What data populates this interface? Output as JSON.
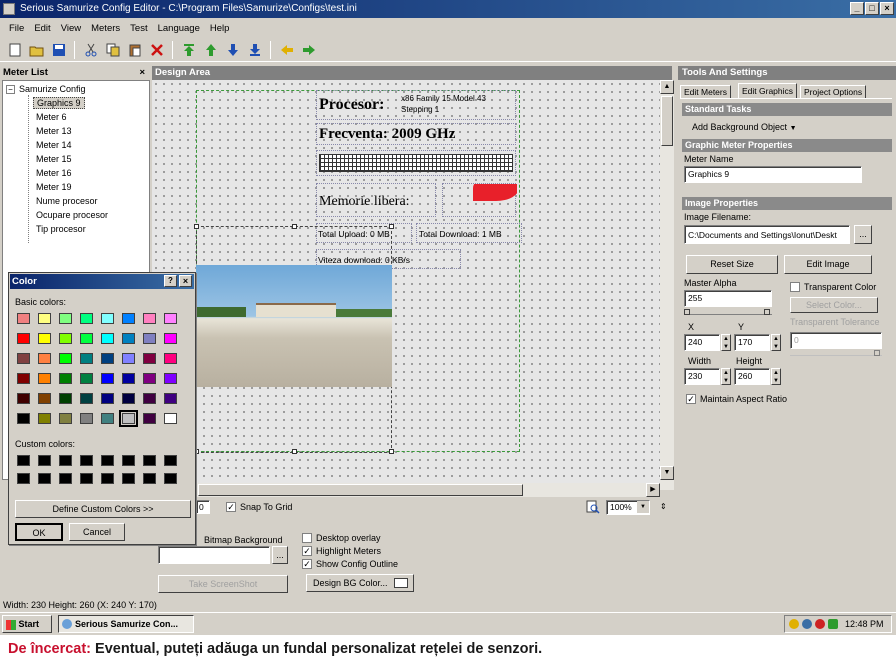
{
  "window": {
    "title": "Serious Samurize Config Editor - C:\\Program Files\\Samurize\\Configs\\test.ini",
    "controls": [
      "_",
      "□",
      "×"
    ]
  },
  "menu": [
    "File",
    "Edit",
    "View",
    "Meters",
    "Test",
    "Language",
    "Help"
  ],
  "toolbar": {
    "icons": [
      "new-icon",
      "open-icon",
      "save-icon",
      "cut-icon",
      "copy-icon",
      "paste-icon",
      "delete-icon",
      "move-top-icon",
      "move-up-icon",
      "move-down-icon",
      "move-bottom-icon",
      "back-icon",
      "forward-icon"
    ],
    "colors": {
      "green": "#2e9b2e",
      "blue": "#1f4fb3",
      "yellow": "#e0b000",
      "red": "#cc1111"
    }
  },
  "meter_list": {
    "title": "Meter List",
    "close": "×",
    "root": "Samurize Config",
    "items": [
      "Graphics 9",
      "Meter 6",
      "Meter 13",
      "Meter 14",
      "Meter 15",
      "Meter 16",
      "Meter 19",
      "Nume procesor",
      "Ocupare procesor",
      "Tip procesor"
    ]
  },
  "design_area": {
    "title": "Design Area",
    "meters": {
      "procesor_label": "Procesor:",
      "procesor_value": "x86 Family 15 Model 43 Stepping 1",
      "frecventa": "Frecventa: 2009 GHz",
      "memorie": "Memorie libera:",
      "upload": "Total Upload: 0 MB",
      "download": "Total Download: 1 MB",
      "viteza": "Viteza download: 0 KB/s"
    },
    "pie_color": "#e8202a",
    "snap_value": "0",
    "snap_label": "Snap To Grid",
    "zoom": "100%"
  },
  "bottom_options": {
    "bitmap_label": "Bitmap Background",
    "desktop_overlay": "Desktop overlay",
    "highlight_meters": "Highlight Meters",
    "show_outline": "Show Config Outline",
    "design_bg": "Design BG Color...",
    "screenshot": "Take ScreenShot",
    "browse": "..."
  },
  "tools": {
    "title": "Tools And Settings",
    "tabs": [
      "Edit Meters",
      "Edit Graphics",
      "Project Options"
    ],
    "active_tab": "Edit Graphics",
    "standard_tasks": "Standard Tasks",
    "add_bg": "Add Background Object",
    "graphic_props": "Graphic Meter Properties",
    "meter_name_label": "Meter Name",
    "meter_name": "Graphics 9",
    "image_props": "Image Properties",
    "image_filename_label": "Image Filename:",
    "image_filename": "C:\\Documents and Settings\\Ionut\\Deskt",
    "browse": "...",
    "reset_size": "Reset Size",
    "edit_image": "Edit Image",
    "master_alpha_label": "Master Alpha",
    "master_alpha": "255",
    "transparent_color": "Transparent Color",
    "select_color": "Select Color...",
    "transparent_tolerance": "Transparent Tolerance",
    "tolerance": "0",
    "x_label": "X",
    "x": "240",
    "y_label": "Y",
    "y": "170",
    "width_label": "Width",
    "width": "230",
    "height_label": "Height",
    "height": "260",
    "maintain_aspect": "Maintain Aspect Ratio"
  },
  "color_dialog": {
    "title": "Color",
    "help": "?",
    "close": "×",
    "basic_label": "Basic colors:",
    "custom_label": "Custom colors:",
    "define": "Define Custom Colors >>",
    "ok": "OK",
    "cancel": "Cancel",
    "basic_colors": [
      "#f08080",
      "#ffff80",
      "#80ff80",
      "#00ff80",
      "#80ffff",
      "#0080ff",
      "#ff80c0",
      "#ff80ff",
      "#ff0000",
      "#ffff00",
      "#80ff00",
      "#00ff40",
      "#00ffff",
      "#0080c0",
      "#8080c0",
      "#ff00ff",
      "#804040",
      "#ff8040",
      "#00ff00",
      "#008080",
      "#004080",
      "#8080ff",
      "#800040",
      "#ff0080",
      "#800000",
      "#ff8000",
      "#008000",
      "#008040",
      "#0000ff",
      "#0000a0",
      "#800080",
      "#8000ff",
      "#400000",
      "#804000",
      "#004000",
      "#004040",
      "#000080",
      "#000040",
      "#400040",
      "#400080",
      "#000000",
      "#808000",
      "#808040",
      "#808080",
      "#408080",
      "#c0c0c0",
      "#400040",
      "#ffffff"
    ],
    "custom_colors": [
      "#000000",
      "#000000",
      "#000000",
      "#000000",
      "#000000",
      "#000000",
      "#000000",
      "#000000",
      "#000000",
      "#000000",
      "#000000",
      "#000000",
      "#000000",
      "#000000",
      "#000000",
      "#000000"
    ]
  },
  "status": "Width: 230 Height: 260 (X: 240 Y: 170)",
  "taskbar": {
    "start": "Start",
    "task": "Serious Samurize Con...",
    "clock": "12:48 PM"
  },
  "caption": {
    "highlight": "De încercat:",
    "text": " Eventual, puteți adăuga un fundal personalizat rețelei de senzori."
  }
}
